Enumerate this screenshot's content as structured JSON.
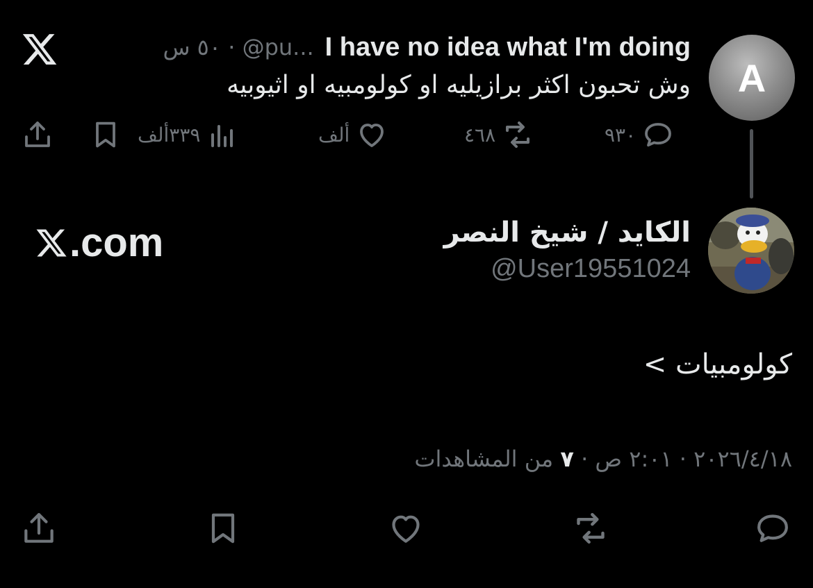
{
  "parent_tweet": {
    "avatar_letter": "A",
    "author_name": "I have no idea what I'm doing",
    "handle_truncated": "@pu...",
    "separator": "·",
    "time": "٥٠ س",
    "text": "وش تحبون اكثر برازيليه او كولومبيه او اثيوبيه",
    "actions": {
      "replies": "٩٣٠",
      "reposts": "٤٦٨",
      "likes": "ألف",
      "views": "٣٣٩ألف"
    }
  },
  "reply_tweet": {
    "display_name": "الكايد / شيخ النصر",
    "handle": "@User19551024",
    "text": "كولومبيات >",
    "date": "٢٠٢٦/٤/١٨",
    "time_label": "٢:٠١ ص",
    "views_count": "٧",
    "views_label": "من المشاهدات",
    "separator": "·"
  },
  "watermark": {
    "logo_letter": "X",
    "text": ".com"
  },
  "icons": {
    "brand": "x-logo-icon",
    "reply": "speech-bubble-icon",
    "repost": "repost-arrows-icon",
    "like": "heart-icon",
    "views": "bar-chart-icon",
    "bookmark": "bookmark-icon",
    "share": "share-upload-icon"
  },
  "colors": {
    "background": "#000000",
    "text_primary": "#e7e9ea",
    "text_muted": "#71767b",
    "thread_line": "#505357"
  }
}
